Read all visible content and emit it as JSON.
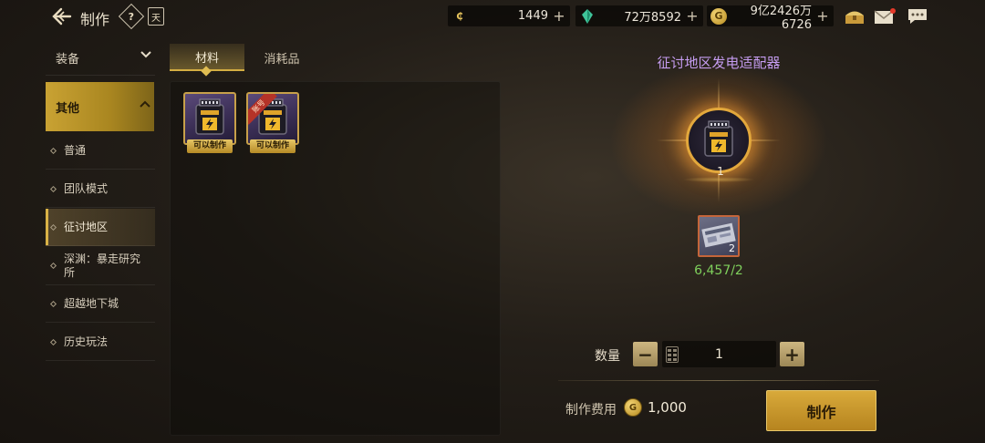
{
  "header": {
    "title": "制作",
    "help_label": "?",
    "book_label": "天",
    "currencies": [
      {
        "icon": "c-coin-icon",
        "value": "1449"
      },
      {
        "icon": "green-crystal-icon",
        "value": "72万8592"
      },
      {
        "icon": "gold-coin-icon",
        "value": "9亿2426万6726"
      }
    ],
    "plus": "+"
  },
  "sidebar": {
    "group_equipment": "装备",
    "group_other": "其他",
    "items": [
      {
        "label": "普通"
      },
      {
        "label": "团队模式"
      },
      {
        "label": "征讨地区"
      },
      {
        "label": "深渊：暴走研究所"
      },
      {
        "label": "超越地下城"
      },
      {
        "label": "历史玩法"
      }
    ],
    "selected_index": 2
  },
  "tabs": [
    {
      "label": "材料"
    },
    {
      "label": "消耗品"
    }
  ],
  "items": [
    {
      "badge": "可以制作",
      "ribbon": ""
    },
    {
      "badge": "可以制作",
      "ribbon": "账号"
    }
  ],
  "detail": {
    "product_name": "征讨地区发电适配器",
    "product_qty": "1",
    "material_count_badge": "2",
    "material_progress": "6,457/2",
    "quantity_label": "数量",
    "quantity_value": "1",
    "minus": "−",
    "plus": "+",
    "cost_label": "制作费用",
    "cost_value": "1,000",
    "craft_button": "制作"
  },
  "colors": {
    "accent_gold": "#c9a233",
    "product_name": "#c59cf0",
    "material_ok": "#7fd05c"
  }
}
